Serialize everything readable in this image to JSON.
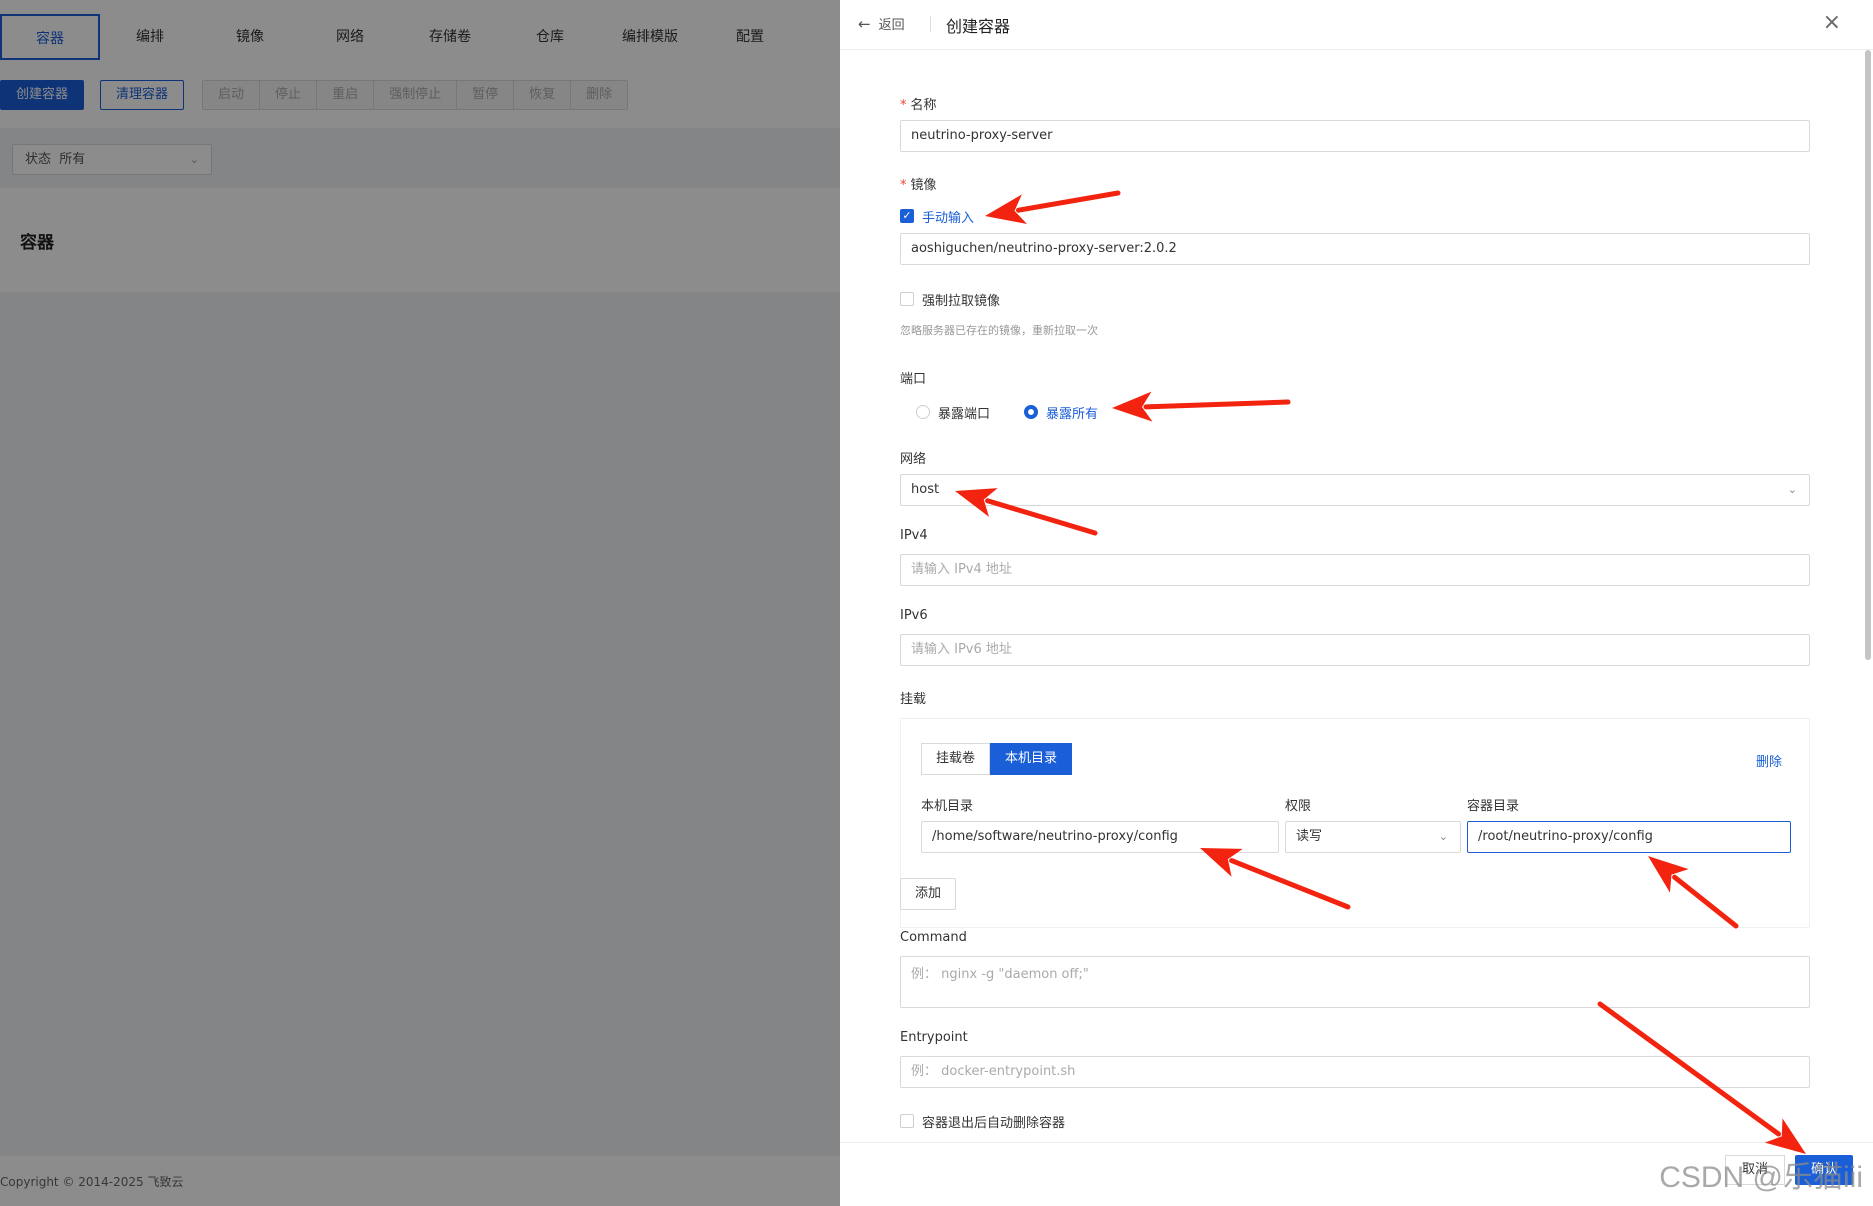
{
  "tabs": [
    "容器",
    "编排",
    "镜像",
    "网络",
    "存储卷",
    "仓库",
    "编排模版",
    "配置"
  ],
  "toolbar": {
    "create_label": "创建容器",
    "clean_label": "清理容器",
    "actions": [
      "启动",
      "停止",
      "重启",
      "强制停止",
      "暂停",
      "恢复",
      "删除"
    ]
  },
  "filter": {
    "status_label": "状态",
    "status_value": "所有"
  },
  "section_title": "容器",
  "footer": {
    "copyright": "Copyright © 2014-2025 飞致云"
  },
  "drawer": {
    "back_label": "返回",
    "title": "创建容器",
    "name": {
      "label": "名称",
      "value": "neutrino-proxy-server"
    },
    "image": {
      "label": "镜像",
      "manual_label": "手动输入",
      "value": "aoshiguchen/neutrino-proxy-server:2.0.2",
      "force_pull_label": "强制拉取镜像",
      "force_pull_hint": "忽略服务器已存在的镜像，重新拉取一次"
    },
    "port": {
      "label": "端口",
      "option_expose_port": "暴露端口",
      "option_expose_all": "暴露所有"
    },
    "network": {
      "label": "网络",
      "value": "host"
    },
    "ipv4": {
      "label": "IPv4",
      "placeholder": "请输入 IPv4 地址"
    },
    "ipv6": {
      "label": "IPv6",
      "placeholder": "请输入 IPv6 地址"
    },
    "mount": {
      "label": "挂载",
      "tab_volume": "挂载卷",
      "tab_host_dir": "本机目录",
      "delete_label": "删除",
      "col_host_dir": "本机目录",
      "col_permission": "权限",
      "col_container_dir": "容器目录",
      "host_dir_value": "/home/software/neutrino-proxy/config",
      "permission_value": "读写",
      "container_dir_value": "/root/neutrino-proxy/config",
      "add_label": "添加"
    },
    "command": {
      "label": "Command",
      "placeholder": "例： nginx -g \"daemon off;\""
    },
    "entrypoint": {
      "label": "Entrypoint",
      "placeholder": "例： docker-entrypoint.sh"
    },
    "auto_remove_label": "容器退出后自动删除容器",
    "cancel_label": "取消",
    "confirm_label": "确认"
  },
  "watermark": "CSDN @乐猫iii",
  "colors": {
    "accent": "#1a5ed8",
    "annotation_arrow": "#f2230f"
  }
}
